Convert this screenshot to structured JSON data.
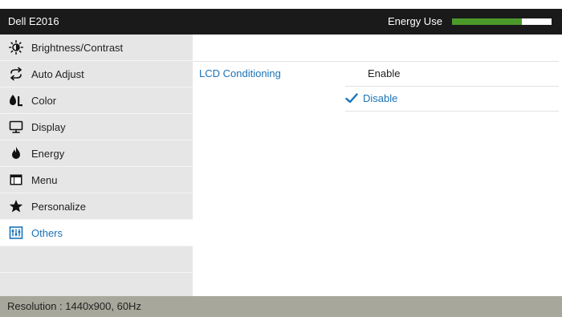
{
  "header": {
    "model": "Dell E2016",
    "energy_label": "Energy Use",
    "energy_level": 0.7
  },
  "sidebar": {
    "items": [
      {
        "label": "Brightness/Contrast",
        "icon": "brightness-icon"
      },
      {
        "label": "Auto Adjust",
        "icon": "auto-adjust-icon"
      },
      {
        "label": "Color",
        "icon": "color-icon"
      },
      {
        "label": "Display",
        "icon": "display-icon"
      },
      {
        "label": "Energy",
        "icon": "energy-icon"
      },
      {
        "label": "Menu",
        "icon": "menu-icon"
      },
      {
        "label": "Personalize",
        "icon": "personalize-icon"
      },
      {
        "label": "Others",
        "icon": "others-icon",
        "selected": true
      }
    ]
  },
  "main": {
    "setting_name": "LCD Conditioning",
    "options": {
      "enable": "Enable",
      "disable": "Disable",
      "selected": "Disable"
    }
  },
  "footer": {
    "resolution": "Resolution : 1440x900, 60Hz"
  },
  "colors": {
    "accent": "#1a73b8",
    "energy_bar": "#4c9a2a",
    "header_bg": "#1a1a1a",
    "sidebar_bg": "#e6e6e6",
    "footer_bg": "#a8a79b"
  }
}
